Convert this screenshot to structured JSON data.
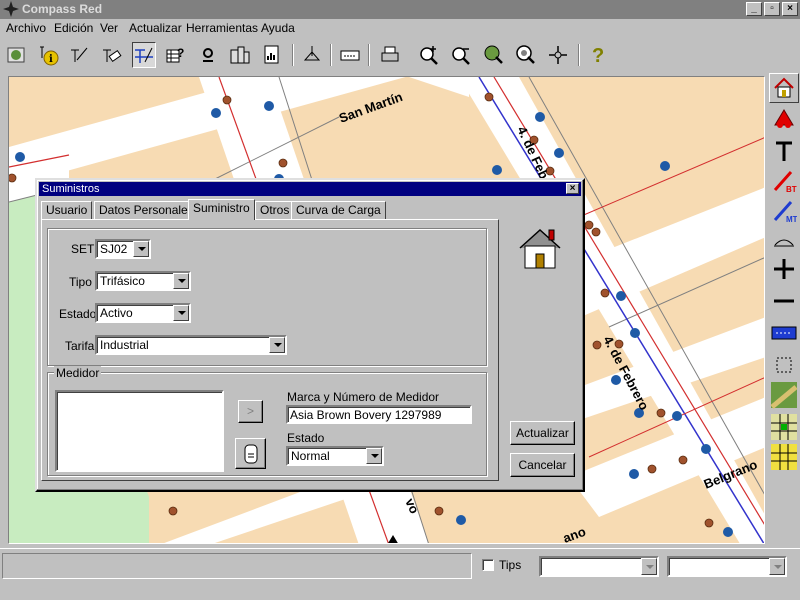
{
  "window": {
    "title": "Compass Red",
    "controls": [
      "_",
      "▫",
      "×"
    ]
  },
  "menu": [
    "Archivo",
    "Edición",
    "Ver",
    "Actualizar",
    "Herramientas",
    "Ayuda"
  ],
  "streets": {
    "san_martin": "San Martín",
    "febrero_upper": "4. de Febr",
    "febrero_lower": "4. de Febrero",
    "belgrano": "Belgrano",
    "vo": "vo",
    "ano": "ano"
  },
  "dialog": {
    "title": "Suministros",
    "tabs": [
      "Usuario",
      "Datos Personales",
      "Suministro",
      "Otros",
      "Curva de Carga"
    ],
    "selected_tab": "Suministro",
    "set_label": "SET",
    "set_value": "SJ02",
    "tipo_label": "Tipo",
    "tipo_value": "Trifásico",
    "estado_label": "Estado",
    "estado_value": "Activo",
    "tarifa_label": "Tarifa",
    "tarifa_value": "Industrial",
    "medidor_group": "Medidor",
    "marca_label": "Marca y Número de Medidor",
    "marca_value": "Asia Brown Bovery   1297989",
    "medidor_estado_label": "Estado",
    "medidor_estado_value": "Normal",
    "arrow_glyph": ">",
    "actualizar": "Actualizar",
    "cancelar": "Cancelar"
  },
  "status": {
    "tips_label": "Tips",
    "tips_checked": false,
    "combo1": "",
    "combo2": ""
  },
  "colors": {
    "map_bg": "#f7dbb3",
    "street": "#ffffff",
    "park": "#c8ecc0",
    "pole": "#1f5aa6",
    "node": "#a0522d",
    "line_red": "#d32f2f",
    "line_blue": "#3333cc",
    "titlebar_active": "#000080"
  }
}
